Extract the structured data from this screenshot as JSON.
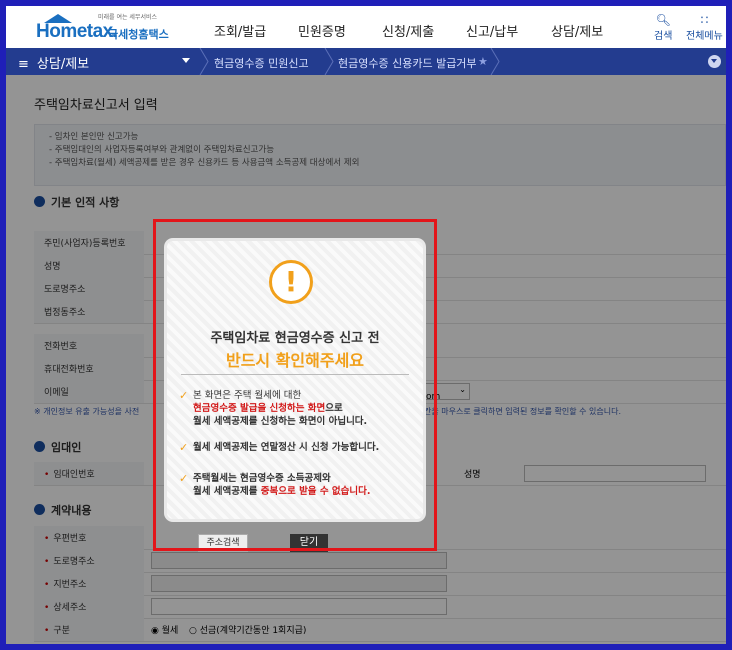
{
  "brand": {
    "tagline": "미래를 여는 세무서비스",
    "logo_text": "Hometax.",
    "logo_kr": "국세청홈택스"
  },
  "nav": [
    "조회/발급",
    "민원증명",
    "신청/제출",
    "신고/납부",
    "상담/제보"
  ],
  "tools": {
    "search": "검색",
    "all_menu": "전체메뉴"
  },
  "bar": {
    "menu": "상담/제보",
    "crumbs": [
      "현금영수증 민원신고",
      "현금영수증 신용카드 발급거부"
    ],
    "star": "★"
  },
  "page": {
    "title": "주택임차료신고서 입력",
    "guide": [
      "- 임차인 본인만 신고가능",
      "- 주택임대인의 사업자등록여부와 관계없이 주택임차료신고가능",
      "- 주택임차료(월세) 세액공제를 받은 경우 신용카드 등 사용금액 소득공제 대상에서 제외"
    ],
    "sections": {
      "basic": "기본 인적 사항",
      "landlord": "임대인",
      "contract": "계약내용"
    },
    "basic_rows": [
      "주민(사업자)등록번호",
      "성명",
      "도로명주소",
      "법정동주소",
      "전화번호",
      "휴대전화번호",
      "이메일"
    ],
    "email_domain": "com",
    "note_left": "※ 개인정보 유출 가능성을 사전",
    "note_right": "칸을 마우스로 클릭하면 입력된 정보를 확인할 수 있습니다.",
    "landlord_row": {
      "label": "임대인번호",
      "name_label": "성명"
    },
    "contract_rows": [
      "우편번호",
      "도로명주소",
      "지번주소",
      "상세주소",
      "구분"
    ],
    "zip_button": "주소검색",
    "type_options": {
      "monthly": "월세",
      "lump": "선금(계약기간동안 1회지급)"
    }
  },
  "modal": {
    "title": "주택임차료 현금영수증 신고 전",
    "subtitle": "반드시 확인해주세요",
    "icon": "exclamation",
    "check1": {
      "a": "본 화면은 주택 월세에 대한",
      "red": "현금영수증 발급을 신청하는 화면",
      "b": "으로",
      "c": "월세 세액공제를 신청하는 화면이 아닙니다."
    },
    "check2": "월세 세액공제는 연말정산 시 신청 가능합니다.",
    "check3": {
      "a": "주택월세는 현금영수증 소득공제와",
      "b": "월세 세액공제를 ",
      "red": "중복으로 받을 수 없습니다.",
      "c": ""
    },
    "close": "닫기"
  },
  "colors": {
    "accent": "#f1a01b",
    "bar": "#233c8f",
    "highlight_border": "#e3151a",
    "frame": "#1f1fb8"
  }
}
